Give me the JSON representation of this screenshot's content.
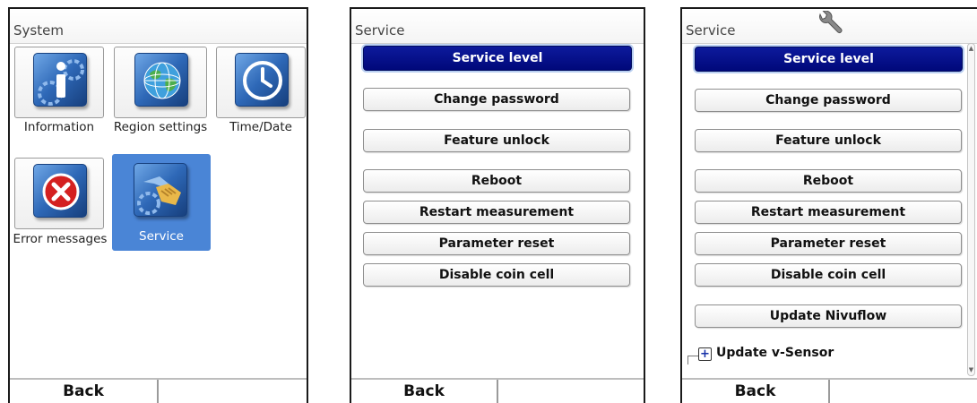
{
  "screens": [
    {
      "title": "System",
      "tiles": [
        {
          "label": "Information",
          "icon": "info-icon",
          "selected": false
        },
        {
          "label": "Region settings",
          "icon": "globe-icon",
          "selected": false
        },
        {
          "label": "Time/Date",
          "icon": "clock-icon",
          "selected": false
        },
        {
          "label": "Error messages",
          "icon": "error-icon",
          "selected": false
        },
        {
          "label": "Service",
          "icon": "service-handshake-icon",
          "selected": true
        }
      ],
      "footer": {
        "back_label": "Back",
        "right_label": ""
      }
    },
    {
      "title": "Service",
      "buttons": [
        {
          "label": "Service level",
          "selected": true
        },
        {
          "label": "Change password"
        },
        {
          "label": "Feature unlock"
        },
        {
          "label": "Reboot"
        },
        {
          "label": "Restart measurement"
        },
        {
          "label": "Parameter reset"
        },
        {
          "label": "Disable coin cell"
        }
      ],
      "footer": {
        "back_label": "Back",
        "right_label": ""
      }
    },
    {
      "title": "Service",
      "title_icon": "wrench-icon",
      "buttons": [
        {
          "label": "Service level",
          "selected": true
        },
        {
          "label": "Change password"
        },
        {
          "label": "Feature unlock"
        },
        {
          "label": "Reboot"
        },
        {
          "label": "Restart measurement"
        },
        {
          "label": "Parameter reset"
        },
        {
          "label": "Disable coin cell"
        },
        {
          "label": "Update Nivuflow"
        }
      ],
      "tree_item": {
        "label": "Update v-Sensor",
        "expander": "+"
      },
      "scrollbar": true,
      "footer": {
        "back_label": "Back",
        "right_label": ""
      }
    }
  ],
  "colors": {
    "primary_button": "#00087a",
    "selection": "#4a85d6",
    "icon_blue": "#2e68b7",
    "error_red": "#d42020"
  }
}
